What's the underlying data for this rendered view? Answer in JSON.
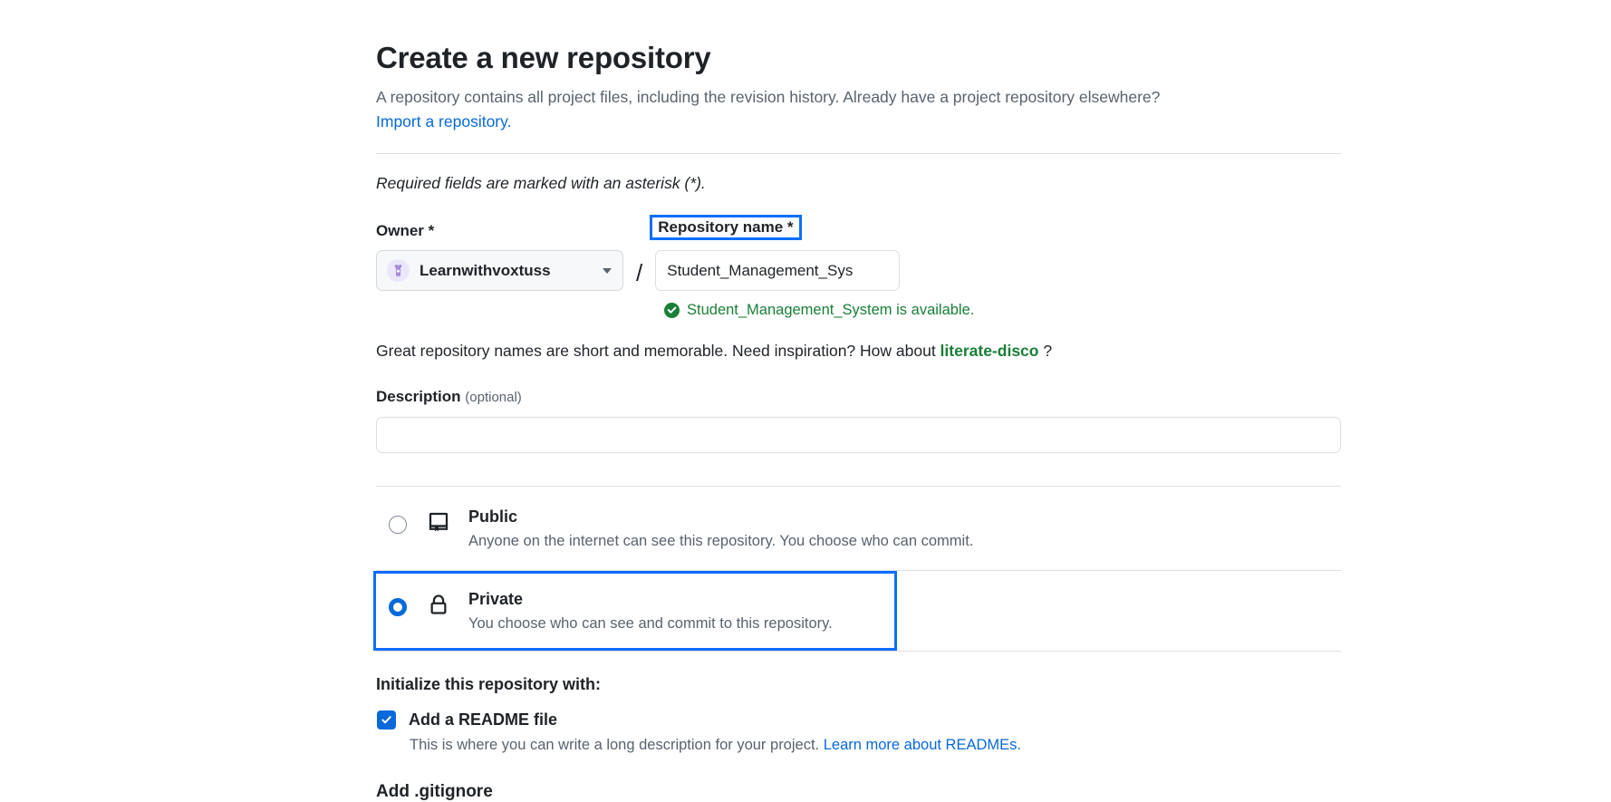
{
  "header": {
    "title": "Create a new repository",
    "subtitle_before": "A repository contains all project files, including the revision history. Already have a project repository elsewhere?",
    "import_link": "Import a repository."
  },
  "required_note": "Required fields are marked with an asterisk (*).",
  "owner": {
    "label": "Owner *",
    "selected": "Learnwithvoxtuss",
    "avatar_icon": "user-avatar-icon",
    "caret_icon": "chevron-down-icon"
  },
  "separator": "/",
  "repo_name": {
    "label": "Repository name *",
    "value": "Student_Management_Sys",
    "placeholder": "",
    "highlighted": true
  },
  "availability": {
    "icon": "check-circle-icon",
    "message": "Student_Management_System is available.",
    "color": "#1a7f37"
  },
  "hint": {
    "before": "Great repository names are short and memorable. Need inspiration? How about ",
    "suggestion": "literate-disco",
    "after": " ?"
  },
  "description": {
    "label": "Description",
    "optional": "(optional)",
    "value": "",
    "placeholder": ""
  },
  "visibility": {
    "options": [
      {
        "id": "public",
        "title": "Public",
        "description": "Anyone on the internet can see this repository. You choose who can commit.",
        "icon": "repo-book-icon",
        "selected": false
      },
      {
        "id": "private",
        "title": "Private",
        "description": "You choose who can see and commit to this repository.",
        "icon": "lock-icon",
        "selected": true
      }
    ]
  },
  "initialize": {
    "title": "Initialize this repository with:",
    "readme": {
      "label": "Add a README file",
      "checked": true,
      "sub_before": "This is where you can write a long description for your project. ",
      "sub_link": "Learn more about READMEs."
    },
    "gitignore_title": "Add .gitignore"
  },
  "colors": {
    "accent_blue": "#0969da",
    "highlight_blue": "#0d6efd",
    "success_green": "#1a7f37",
    "muted_text": "#59636e",
    "border": "#d8dee4"
  }
}
